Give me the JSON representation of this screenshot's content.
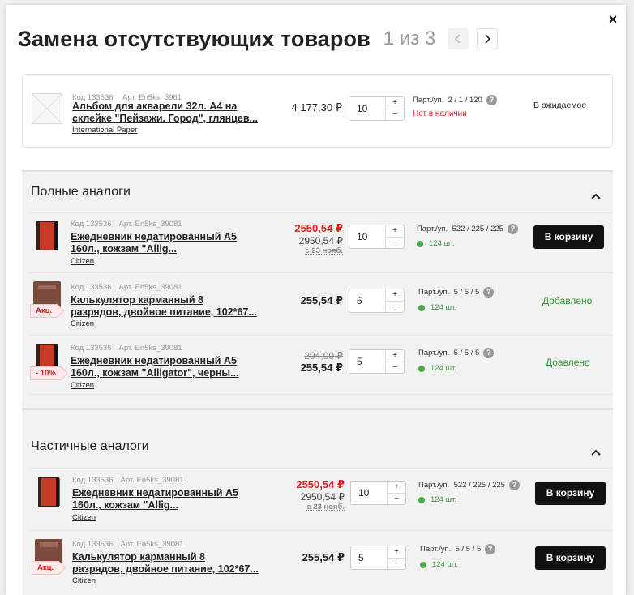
{
  "modal": {
    "title": "Замена отсутствующих товаров",
    "pager": "1 из 3",
    "close_glyph": "×",
    "prev_icon": "chevron-left-icon",
    "next_icon": "chevron-right-icon"
  },
  "original": {
    "code": "Код 133536",
    "art": "Арт. En5ks_3981",
    "name_line1": "Альбом для акварели 32л. А4 на",
    "name_line2": "склейке \"Пейзажи. Город\", глянцев...",
    "brand": "International Paper",
    "price": "4 177,30 ₽",
    "qty": "10",
    "pack_label": "Парт./уп.",
    "pack_value": "2 / 1 / 120",
    "stock": "Нет в наличии",
    "action": "В ожидаемое"
  },
  "qty_controls": {
    "plus": "+",
    "minus": "−"
  },
  "help_glyph": "?",
  "full": {
    "title": "Полные аналоги",
    "rows": [
      {
        "code": "Код 133536",
        "art": "Арт. En5ks_39081",
        "name_line1": "Ежедневник недатированный А5",
        "name_line2": "160л., кожзам \"Allig...",
        "brand": "Citizen",
        "price_new": "2550,54 ₽",
        "price_old": "2950,54 ₽",
        "price_date": "с 23 нояб.",
        "qty": "10",
        "pack_label": "Парт./уп.",
        "pack_value": "522 / 225 / 225",
        "stock": "124 шт.",
        "action": "В корзину"
      },
      {
        "code": "Код 133536",
        "art": "Арт. En5ks_39081",
        "name_line1": "Калькулятор карманный 8",
        "name_line2": "разрядов, двойное питание, 102*67...",
        "brand": "Citizen",
        "badge": "Акц.",
        "price": "255,54 ₽",
        "qty": "5",
        "pack_label": "Парт./уп.",
        "pack_value": "5 / 5 / 5",
        "stock": "124 шт.",
        "action": "Добавлено"
      },
      {
        "code": "Код 133536",
        "art": "Арт. En5ks_39081",
        "name_line1": "Ежедневник недатированный А5",
        "name_line2": "160л., кожзам \"Alligator\", черны...",
        "brand": "Citizen",
        "badge": "- 10%",
        "price_strike": "294,00 ₽",
        "price": "255,54 ₽",
        "qty": "5",
        "pack_label": "Парт./уп.",
        "pack_value": "5 / 5 / 5",
        "stock": "124 шт.",
        "action": "Доавлено"
      }
    ]
  },
  "partial": {
    "title": "Частичные аналоги",
    "rows": [
      {
        "code": "Код 133536",
        "art": "Арт. En5ks_39081",
        "name_line1": "Ежедневник недатированный А5",
        "name_line2": "160л., кожзам \"Allig...",
        "brand": "Citizen",
        "price_new": "2550,54 ₽",
        "price_old": "2950,54 ₽",
        "price_date": "с 23 нояб.",
        "qty": "10",
        "pack_label": "Парт./уп.",
        "pack_value": "522 / 225 / 225",
        "stock": "124 шт.",
        "action": "В корзину"
      },
      {
        "code": "Код 133536",
        "art": "Арт. En5ks_39081",
        "name_line1": "Калькулятор карманный 8",
        "name_line2": "разрядов, двойное питание, 102*67...",
        "brand": "Citizen",
        "badge": "Акц.",
        "price": "255,54 ₽",
        "qty": "5",
        "pack_label": "Парт./уп.",
        "pack_value": "5 / 5 / 5",
        "stock": "124 шт.",
        "action": "В корзину"
      }
    ]
  },
  "colors": {
    "accent_red": "#e02222",
    "success_green": "#2f9a2f",
    "button_black": "#111111",
    "stock_dot": "#4aab4a"
  }
}
